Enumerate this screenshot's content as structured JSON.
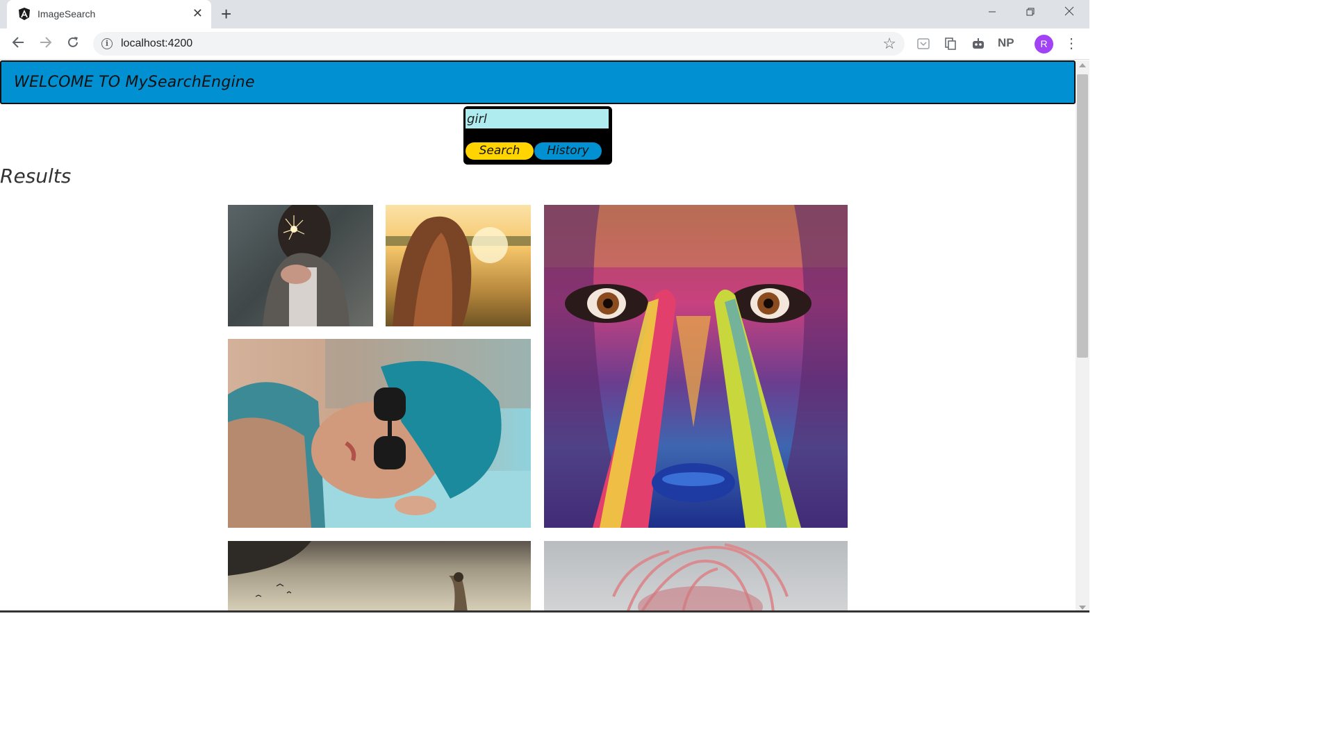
{
  "browser": {
    "tab_title": "ImageSearch",
    "tab_close": "✕",
    "new_tab": "+",
    "url": "localhost:4200",
    "ext_np": "NP",
    "avatar_initial": "R"
  },
  "header": {
    "title": "WELCOME TO MySearchEngine"
  },
  "search": {
    "query": "girl",
    "search_label": "Search",
    "history_label": "History"
  },
  "results": {
    "title": "Results"
  },
  "colors": {
    "header_bg": "#0190d1",
    "input_bg": "#afecef",
    "search_btn": "#ffd400",
    "history_btn": "#0190d1"
  }
}
